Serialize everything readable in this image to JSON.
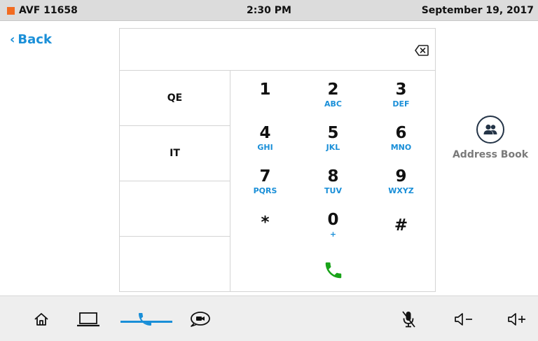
{
  "status": {
    "device": "AVF 11658",
    "time": "2:30 PM",
    "date": "September 19, 2017",
    "accent": "#f26b21"
  },
  "nav": {
    "back_label": "Back"
  },
  "speed_dials": [
    "QE",
    "IT",
    "",
    ""
  ],
  "keypad": [
    {
      "digit": "1",
      "letters": ""
    },
    {
      "digit": "2",
      "letters": "ABC"
    },
    {
      "digit": "3",
      "letters": "DEF"
    },
    {
      "digit": "4",
      "letters": "GHI"
    },
    {
      "digit": "5",
      "letters": "JKL"
    },
    {
      "digit": "6",
      "letters": "MNO"
    },
    {
      "digit": "7",
      "letters": "PQRS"
    },
    {
      "digit": "8",
      "letters": "TUV"
    },
    {
      "digit": "9",
      "letters": "WXYZ"
    },
    {
      "digit": "*",
      "letters": ""
    },
    {
      "digit": "0",
      "letters": "+"
    },
    {
      "digit": "#",
      "letters": ""
    }
  ],
  "address_book": {
    "label": "Address Book"
  },
  "icons": {
    "clear": "backspace-icon",
    "call": "phone-icon",
    "address_book": "contacts-icon",
    "home": "home-icon",
    "laptop": "laptop-icon",
    "phone_tab": "phone-icon",
    "chat": "video-chat-icon",
    "mic_mute": "mic-mute-icon",
    "vol_down": "volume-down-icon",
    "vol_up": "volume-up-icon"
  },
  "colors": {
    "link": "#1a8fd8",
    "call": "#19a319",
    "accent": "#f26b21"
  }
}
